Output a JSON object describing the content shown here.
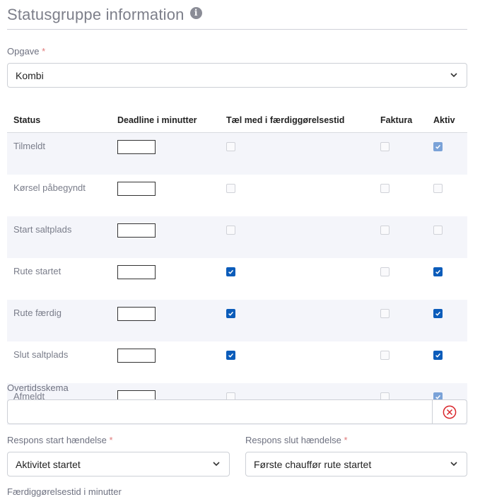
{
  "header": {
    "title": "Statusgruppe information",
    "info_icon": "info-icon"
  },
  "opgave": {
    "label": "Opgave",
    "required_mark": "*",
    "value": "Kombi"
  },
  "table": {
    "columns": [
      "Status",
      "Deadline i minutter",
      "Tæl med i færdiggørelsestid",
      "Faktura",
      "Aktiv"
    ],
    "rows": [
      {
        "name": "Tilmeldt",
        "deadline": "",
        "taelmed": "off",
        "faktura": "off",
        "aktiv": "on-dim"
      },
      {
        "name": "Kørsel påbegyndt",
        "deadline": "",
        "taelmed": "off",
        "faktura": "off",
        "aktiv": "off"
      },
      {
        "name": "Start saltplads",
        "deadline": "",
        "taelmed": "off",
        "faktura": "off",
        "aktiv": "off"
      },
      {
        "name": "Rute startet",
        "deadline": "",
        "taelmed": "on",
        "faktura": "off",
        "aktiv": "on"
      },
      {
        "name": "Rute færdig",
        "deadline": "",
        "taelmed": "on",
        "faktura": "off",
        "aktiv": "on"
      },
      {
        "name": "Slut saltplads",
        "deadline": "",
        "taelmed": "on",
        "faktura": "off",
        "aktiv": "on"
      },
      {
        "name": "Afmeldt",
        "deadline": "",
        "taelmed": "off",
        "faktura": "off",
        "aktiv": "on-dim"
      }
    ]
  },
  "overtid": {
    "label": "Overtidsskema",
    "value": "",
    "clear_icon": "clear-icon"
  },
  "respons_start": {
    "label": "Respons start hændelse",
    "required_mark": "*",
    "value": "Aktivitet startet"
  },
  "respons_slut": {
    "label": "Respons slut hændelse",
    "required_mark": "*",
    "value": "Første chauffør rute startet"
  },
  "faerdig": {
    "label": "Færdiggørelsestid i minutter"
  },
  "colors": {
    "accent": "#0b5cba",
    "accent_disabled": "#7aa2d8",
    "row_shade": "#f4f5fa",
    "clear_red": "#d9262b"
  }
}
